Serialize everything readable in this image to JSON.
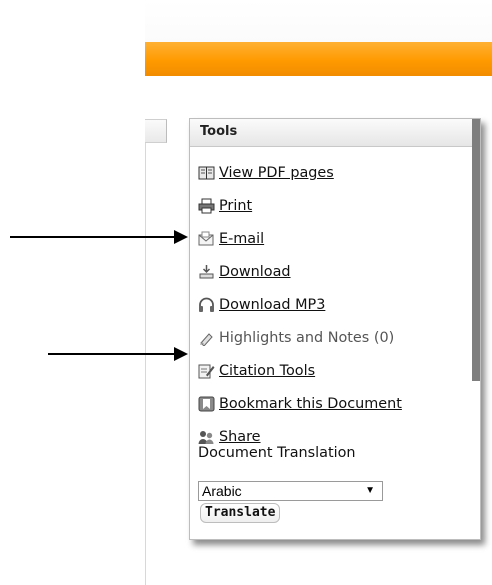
{
  "tools_panel": {
    "title": "Tools",
    "items": [
      {
        "label": "View PDF pages",
        "icon": "book-icon",
        "enabled": true
      },
      {
        "label": "Print",
        "icon": "printer-icon",
        "enabled": true
      },
      {
        "label": "E-mail",
        "icon": "email-icon",
        "enabled": true
      },
      {
        "label": "Download",
        "icon": "download-icon",
        "enabled": true
      },
      {
        "label": "Download MP3",
        "icon": "headphones-icon",
        "enabled": true
      },
      {
        "label": "Highlights and Notes (0)",
        "icon": "highlighter-icon",
        "enabled": false
      },
      {
        "label": "Citation Tools",
        "icon": "citation-icon",
        "enabled": true
      },
      {
        "label": "Bookmark this Document",
        "icon": "bookmark-icon",
        "enabled": true
      },
      {
        "label": "Share",
        "icon": "share-icon",
        "enabled": true
      }
    ],
    "translation": {
      "label": "Document Translation",
      "selected_language": "Arabic",
      "button_label": "Translate"
    }
  },
  "colors": {
    "banner_orange": "#ff9a00",
    "annotation_arrow": "#000000"
  }
}
